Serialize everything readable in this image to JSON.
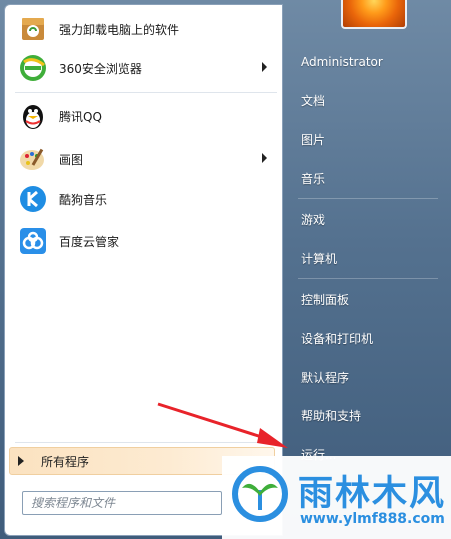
{
  "programs": [
    {
      "label": "强力卸载电脑上的软件",
      "icon": "uninstall-icon"
    },
    {
      "label": "360安全浏览器",
      "icon": "360-browser-icon",
      "has_submenu": true
    },
    {
      "label": "腾讯QQ",
      "icon": "qq-penguin-icon"
    },
    {
      "label": "画图",
      "icon": "paint-palette-icon",
      "has_submenu": true
    },
    {
      "label": "酷狗音乐",
      "icon": "kugou-icon"
    },
    {
      "label": "百度云管家",
      "icon": "baidu-cloud-icon"
    }
  ],
  "all_programs_label": "所有程序",
  "search": {
    "placeholder": "搜索程序和文件"
  },
  "right_menu": {
    "user": "Administrator",
    "documents": "文档",
    "pictures": "图片",
    "music": "音乐",
    "games": "游戏",
    "computer": "计算机",
    "control_panel": "控制面板",
    "devices_printers": "设备和打印机",
    "default_programs": "默认程序",
    "help_support": "帮助和支持",
    "run": "运行..."
  },
  "watermark": {
    "title": "雨林木风",
    "url": "www.ylmf888.com"
  },
  "colors": {
    "arrow": "#e8232a",
    "watermark": "#2b8fe0",
    "menu_right_bg": "#5b7591"
  }
}
